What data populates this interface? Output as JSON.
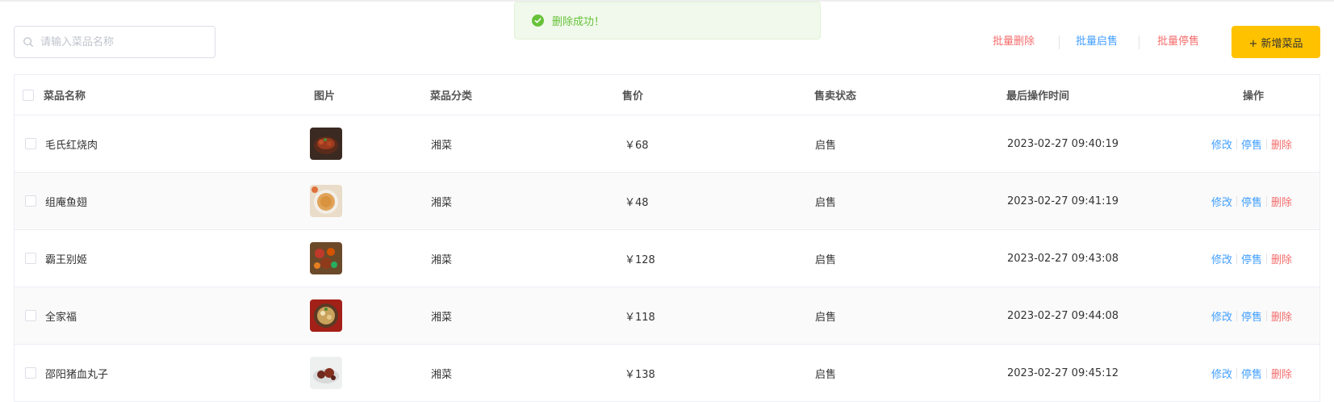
{
  "toast": {
    "message": "删除成功！",
    "icon": "check-circle-icon",
    "color": "#67c23a"
  },
  "search": {
    "placeholder": "请输入菜品名称",
    "value": ""
  },
  "toolbar": {
    "batch_delete": "批量删除",
    "batch_enable": "批量启售",
    "batch_disable": "批量停售",
    "add_label": "+ 新增菜品",
    "accent": "#ffc200",
    "danger_color": "#f56c6c",
    "primary_color": "#409eff"
  },
  "table": {
    "columns": [
      "菜品名称",
      "图片",
      "菜品分类",
      "售价",
      "售卖状态",
      "最后操作时间",
      "操作"
    ],
    "rows": [
      {
        "name": "毛氏红烧肉",
        "category": "湘菜",
        "price": "￥68",
        "status": "启售",
        "time": "2023-02-27 09:40:19",
        "edit": "修改",
        "toggle": "停售",
        "delete": "删除"
      },
      {
        "name": "组庵鱼翅",
        "category": "湘菜",
        "price": "￥48",
        "status": "启售",
        "time": "2023-02-27 09:41:19",
        "edit": "修改",
        "toggle": "停售",
        "delete": "删除"
      },
      {
        "name": "霸王别姬",
        "category": "湘菜",
        "price": "￥128",
        "status": "启售",
        "time": "2023-02-27 09:43:08",
        "edit": "修改",
        "toggle": "停售",
        "delete": "删除"
      },
      {
        "name": "全家福",
        "category": "湘菜",
        "price": "￥118",
        "status": "启售",
        "time": "2023-02-27 09:44:08",
        "edit": "修改",
        "toggle": "停售",
        "delete": "删除"
      },
      {
        "name": "邵阳猪血丸子",
        "category": "湘菜",
        "price": "￥138",
        "status": "启售",
        "time": "2023-02-27 09:45:12",
        "edit": "修改",
        "toggle": "停售",
        "delete": "删除"
      }
    ]
  }
}
